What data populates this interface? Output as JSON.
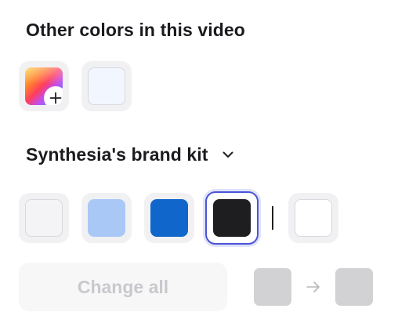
{
  "other_colors": {
    "title": "Other colors in this video",
    "swatches": [
      {
        "type": "picker",
        "icon": "plus-icon"
      },
      {
        "type": "color",
        "color": "#f2f6ff"
      }
    ]
  },
  "brand_kit": {
    "title": "Synthesia's brand kit",
    "dropdown_icon": "chevron-down-icon",
    "swatches": [
      {
        "color": "#f4f4f6",
        "selected": false
      },
      {
        "color": "#a9c8f6",
        "selected": false
      },
      {
        "color": "#1166cc",
        "selected": false
      },
      {
        "color": "#1e1e20",
        "selected": true
      },
      {
        "color": "#ffffff",
        "selected": false
      }
    ]
  },
  "actions": {
    "change_all_label": "Change all",
    "from_color": "#d2d2d4",
    "to_color": "#d2d2d4",
    "arrow_icon": "arrow-right-icon"
  },
  "colors": {
    "selected_border": "#4a55d6",
    "disabled_text": "#c9c9cd"
  }
}
